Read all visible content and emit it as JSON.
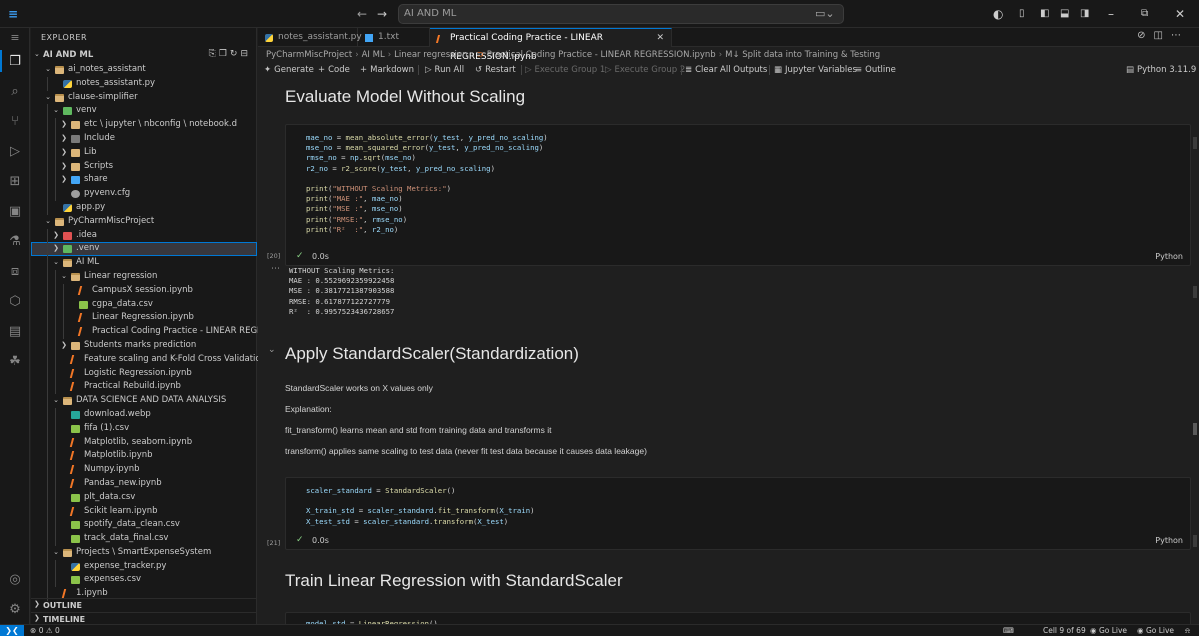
{
  "titlebar": {
    "search_text": "AI AND ML"
  },
  "explorer": {
    "header": "EXPLORER",
    "root": "AI AND ML",
    "tree": [
      {
        "label": "ai_notes_assistant",
        "depth": 1,
        "type": "folder-open",
        "chev": "v"
      },
      {
        "label": "notes_assistant.py",
        "depth": 2,
        "type": "py"
      },
      {
        "label": "clause-simplifier",
        "depth": 1,
        "type": "folder-open",
        "chev": "v"
      },
      {
        "label": "venv",
        "depth": 2,
        "type": "venv",
        "chev": "v"
      },
      {
        "label": "etc \\ jupyter \\ nbconfig \\ notebook.d",
        "depth": 3,
        "type": "folder",
        "chev": ">"
      },
      {
        "label": "Include",
        "depth": 3,
        "type": "gray",
        "chev": ">"
      },
      {
        "label": "Lib",
        "depth": 3,
        "type": "folder",
        "chev": ">"
      },
      {
        "label": "Scripts",
        "depth": 3,
        "type": "folder",
        "chev": ">"
      },
      {
        "label": "share",
        "depth": 3,
        "type": "txtf",
        "chev": ">"
      },
      {
        "label": "pyvenv.cfg",
        "depth": 3,
        "type": "cfg"
      },
      {
        "label": "app.py",
        "depth": 2,
        "type": "py"
      },
      {
        "label": "PyCharmMiscProject",
        "depth": 1,
        "type": "folder-open",
        "chev": "v"
      },
      {
        "label": ".idea",
        "depth": 2,
        "type": "red",
        "chev": ">"
      },
      {
        "label": ".venv",
        "depth": 2,
        "type": "venv",
        "chev": ">",
        "selected": true
      },
      {
        "label": "AI ML",
        "depth": 2,
        "type": "folder-open",
        "chev": "v"
      },
      {
        "label": "Linear regression",
        "depth": 3,
        "type": "folder-open",
        "chev": "v"
      },
      {
        "label": "CampusX session.ipynb",
        "depth": 4,
        "type": "nb"
      },
      {
        "label": "cgpa_data.csv",
        "depth": 4,
        "type": "csv"
      },
      {
        "label": "Linear Regression.ipynb",
        "depth": 4,
        "type": "nb"
      },
      {
        "label": "Practical Coding Practice - LINEAR REGRESSION...",
        "depth": 4,
        "type": "nb"
      },
      {
        "label": "Students marks prediction",
        "depth": 3,
        "type": "folder",
        "chev": ">"
      },
      {
        "label": "Feature scaling and K-Fold Cross Validation.ipynb",
        "depth": 3,
        "type": "nb"
      },
      {
        "label": "Logistic Regression.ipynb",
        "depth": 3,
        "type": "nb"
      },
      {
        "label": "Practical Rebuild.ipynb",
        "depth": 3,
        "type": "nb"
      },
      {
        "label": "DATA SCIENCE AND DATA ANALYSIS",
        "depth": 2,
        "type": "folder-open",
        "chev": "v"
      },
      {
        "label": "download.webp",
        "depth": 3,
        "type": "img"
      },
      {
        "label": "fifa (1).csv",
        "depth": 3,
        "type": "csv"
      },
      {
        "label": "Matplotlib, seaborn.ipynb",
        "depth": 3,
        "type": "nb"
      },
      {
        "label": "Matplotlib.ipynb",
        "depth": 3,
        "type": "nb"
      },
      {
        "label": "Numpy.ipynb",
        "depth": 3,
        "type": "nb"
      },
      {
        "label": "Pandas_new.ipynb",
        "depth": 3,
        "type": "nb"
      },
      {
        "label": "plt_data.csv",
        "depth": 3,
        "type": "csv"
      },
      {
        "label": "Scikit learn.ipynb",
        "depth": 3,
        "type": "nb"
      },
      {
        "label": "spotify_data_clean.csv",
        "depth": 3,
        "type": "csv"
      },
      {
        "label": "track_data_final.csv",
        "depth": 3,
        "type": "csv"
      },
      {
        "label": "Projects \\ SmartExpenseSystem",
        "depth": 2,
        "type": "folder-open",
        "chev": "v"
      },
      {
        "label": "expense_tracker.py",
        "depth": 3,
        "type": "py"
      },
      {
        "label": "expenses.csv",
        "depth": 3,
        "type": "csv"
      },
      {
        "label": "1.ipynb",
        "depth": 2,
        "type": "nb"
      }
    ],
    "sections": [
      "OUTLINE",
      "TIMELINE"
    ]
  },
  "tabs": [
    {
      "label": "notes_assistant.py",
      "active": false
    },
    {
      "label": "1.txt",
      "active": false
    },
    {
      "label": "Practical Coding Practice - LINEAR REGRESSION.ipynb",
      "active": true
    }
  ],
  "breadcrumb": [
    "PyCharmMiscProject",
    "AI ML",
    "Linear regression",
    "Practical Coding Practice - LINEAR REGRESSION.ipynb",
    "M↓ Split data into Training & Testing"
  ],
  "toolbar": {
    "generate": "Generate",
    "code": "Code",
    "markdown": "Markdown",
    "run_all": "Run All",
    "restart": "Restart",
    "exec_group_1": "Execute Group 1",
    "exec_group_2": "Execute Group 2",
    "clear_outputs": "Clear All Outputs",
    "jupyter_vars": "Jupyter Variables",
    "outline": "Outline",
    "kernel": "Python 3.11.9"
  },
  "notebook": {
    "h1": "Evaluate Model Without Scaling",
    "cell20": {
      "count": "[20]",
      "time": "0.0s",
      "lang": "Python"
    },
    "output20": "WITHOUT Scaling Metrics:\nMAE : 0.5529692359922458\nMSE : 0.3817721387903588\nRMSE: 0.617877122727779\nR²  : 0.9957523436728657",
    "h2": "Apply StandardScaler(Standardization)",
    "p1": "StandardScaler works on X values only",
    "p2": "Explanation:",
    "p3": "fit_transform() learns mean and std from training data and transforms it",
    "p4": "transform() applies same scaling to test data (never fit test data because it causes data leakage)",
    "cell21": {
      "count": "[21]",
      "time": "0.0s",
      "lang": "Python"
    },
    "h3": "Train Linear Regression with StandardScaler"
  },
  "status": {
    "errors": "0",
    "warnings": "0",
    "cell": "Cell 9 of 69",
    "golive1": "Go Live",
    "golive2": "Go Live"
  }
}
